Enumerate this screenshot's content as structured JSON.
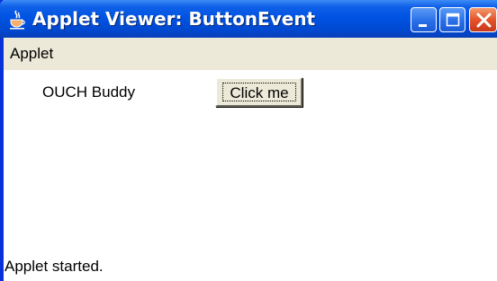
{
  "window": {
    "title": "Applet Viewer: ButtonEvent",
    "app_icon": "java-coffee-cup-icon",
    "controls": [
      "minimize-icon",
      "maximize-icon",
      "close-icon"
    ]
  },
  "menubar": {
    "items": [
      {
        "label": "Applet"
      }
    ]
  },
  "applet": {
    "label_text": "OUCH Buddy",
    "button_label": "Click me"
  },
  "status": {
    "text": "Applet started."
  },
  "colors": {
    "titlebar": "#0054e3",
    "close_button": "#e5532a",
    "menubar": "#ece9d8",
    "button_face": "#ece9d8",
    "content_bg": "#ffffff"
  }
}
